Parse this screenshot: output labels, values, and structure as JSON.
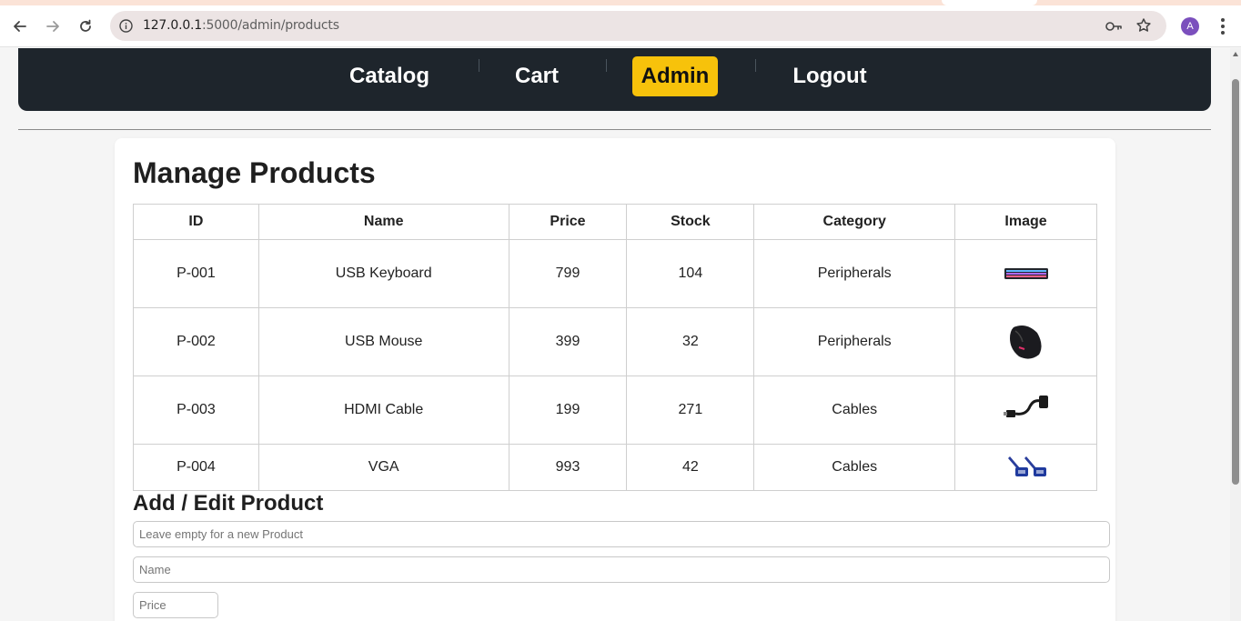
{
  "browser": {
    "url_host": "127.0.0.1",
    "url_rest": ":5000/admin/products",
    "avatar_letter": "A"
  },
  "nav": {
    "items": [
      {
        "label": "Catalog",
        "active": false
      },
      {
        "label": "Cart",
        "active": false
      },
      {
        "label": "Admin",
        "active": true
      },
      {
        "label": "Logout",
        "active": false
      }
    ]
  },
  "page": {
    "title": "Manage Products"
  },
  "table": {
    "headers": [
      "ID",
      "Name",
      "Price",
      "Stock",
      "Category",
      "Image"
    ],
    "rows": [
      {
        "id": "P-001",
        "name": "USB Keyboard",
        "price": "799",
        "stock": "104",
        "category": "Peripherals",
        "image": "keyboard-image"
      },
      {
        "id": "P-002",
        "name": "USB Mouse",
        "price": "399",
        "stock": "32",
        "category": "Peripherals",
        "image": "mouse-image"
      },
      {
        "id": "P-003",
        "name": "HDMI Cable",
        "price": "199",
        "stock": "271",
        "category": "Cables",
        "image": "hdmi-cable-image"
      },
      {
        "id": "P-004",
        "name": "VGA",
        "price": "993",
        "stock": "42",
        "category": "Cables",
        "image": "vga-cable-image"
      }
    ]
  },
  "form": {
    "title": "Add / Edit Product",
    "id_placeholder": "Leave empty for a new Product",
    "name_placeholder": "Name",
    "price_placeholder": "Price"
  }
}
